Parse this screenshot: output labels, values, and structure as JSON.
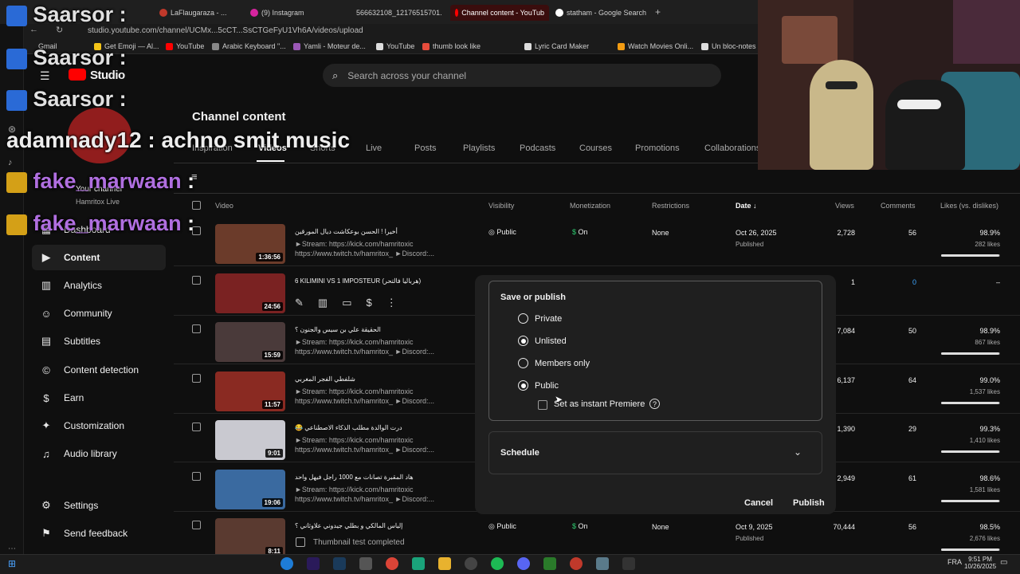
{
  "browser": {
    "tabs": [
      {
        "label": "LaFlaugaraza - ...",
        "active": false
      },
      {
        "label": "(9) Instagram",
        "active": false
      },
      {
        "label": "566632108_12176515701...",
        "active": false
      },
      {
        "label": "Channel content - YouTub",
        "active": true
      },
      {
        "label": "statham - Google Search",
        "active": false
      }
    ],
    "url": "studio.youtube.com/channel/UCMx...5cCT...SsCTGeFyU1Vh6A/videos/upload",
    "bookmarks": [
      "Gmail",
      "Get Emoji — Al...",
      "YouTube",
      "Arabic Keyboard \"...",
      "Yamli - Moteur de...",
      "YouTube",
      "thumb look like",
      "Lyric Card Maker",
      "Watch Movies Onli...",
      "Un bloc-notes e..."
    ]
  },
  "studio": {
    "logo_label": "Studio",
    "search_placeholder": "Search across your channel",
    "channel_label": "Your channel",
    "channel_name": "Hamritox Live",
    "nav": [
      {
        "label": "Dashboard",
        "icon": "dashboard-icon"
      },
      {
        "label": "Content",
        "icon": "content-icon"
      },
      {
        "label": "Analytics",
        "icon": "analytics-icon"
      },
      {
        "label": "Community",
        "icon": "community-icon"
      },
      {
        "label": "Subtitles",
        "icon": "subtitles-icon"
      },
      {
        "label": "Content detection",
        "icon": "copyright-icon"
      },
      {
        "label": "Earn",
        "icon": "dollar-icon"
      },
      {
        "label": "Customization",
        "icon": "wand-icon"
      },
      {
        "label": "Audio library",
        "icon": "audio-icon"
      }
    ],
    "nav_bottom": [
      {
        "label": "Settings",
        "icon": "gear-icon"
      },
      {
        "label": "Send feedback",
        "icon": "feedback-icon"
      }
    ]
  },
  "page": {
    "title": "Channel content",
    "tabs": [
      "Inspiration",
      "Videos",
      "Shorts",
      "Live",
      "Posts",
      "Playlists",
      "Podcasts",
      "Courses",
      "Promotions",
      "Collaborations"
    ],
    "columns": [
      "Video",
      "Visibility",
      "Monetization",
      "Restrictions",
      "Date",
      "Views",
      "Comments",
      "Likes (vs. dislikes)"
    ]
  },
  "videos": [
    {
      "title": "أخيرا ! الحسن بوعكاشت ديال المورقين",
      "desc1": "►Stream: https://kick.com/hamritoxic",
      "desc2": "https://www.twitch.tv/hamritox_ ►Discord:...",
      "duration": "1:36:56",
      "visibility": "Public",
      "monetization": "On",
      "restrictions": "None",
      "date": "Oct 26, 2025",
      "date_status": "Published",
      "views": "2,728",
      "comments": "56",
      "likes_pct": "98.9%",
      "likes_count": "282 likes",
      "like_ratio": 0.989,
      "thumb_color": "#6b3b2a"
    },
    {
      "title": "6 KILIMINI VS 1 IMPOSTEUR (هرباليا فالتحر)",
      "desc1": "",
      "desc2": "",
      "duration": "24:56",
      "visibility": "",
      "monetization": "",
      "restrictions": "",
      "date": "",
      "date_status": "",
      "views": "1",
      "comments": "0",
      "likes_pct": "–",
      "likes_count": "",
      "like_ratio": 0,
      "thumb_color": "#7a2222"
    },
    {
      "title": "الحقيقة علي بن سيس والجنون ؟",
      "desc1": "►Stream: https://kick.com/hamritoxic",
      "desc2": "https://www.twitch.tv/hamritox_ ►Discord:...",
      "duration": "15:59",
      "visibility": "",
      "monetization": "",
      "restrictions": "",
      "date": "",
      "date_status": "",
      "views": "7,084",
      "comments": "50",
      "likes_pct": "98.9%",
      "likes_count": "867 likes",
      "like_ratio": 0.989,
      "thumb_color": "#4a3a3a"
    },
    {
      "title": "شلفطي الفجر المغربي",
      "desc1": "►Stream: https://kick.com/hamritoxic",
      "desc2": "https://www.twitch.tv/hamritox_ ►Discord:...",
      "duration": "11:57",
      "visibility": "",
      "monetization": "",
      "restrictions": "",
      "date": "",
      "date_status": "",
      "views": "6,137",
      "comments": "64",
      "likes_pct": "99.0%",
      "likes_count": "1,537 likes",
      "like_ratio": 0.99,
      "thumb_color": "#8a2a22"
    },
    {
      "title": "😂 درت الوالدة مطلب الذكاء الاصطناعي",
      "desc1": "►Stream: https://kick.com/hamritoxic",
      "desc2": "https://www.twitch.tv/hamritox_ ►Discord:...",
      "duration": "9:01",
      "visibility": "",
      "monetization": "",
      "restrictions": "",
      "date": "",
      "date_status": "",
      "views": "1,390",
      "comments": "29",
      "likes_pct": "99.3%",
      "likes_count": "1,410 likes",
      "like_ratio": 0.993,
      "thumb_color": "#c9c9d0"
    },
    {
      "title": "هاد المقبرة تصانات مع 1000 راجل فيهل واحد",
      "desc1": "►Stream: https://kick.com/hamritoxic",
      "desc2": "https://www.twitch.tv/hamritox_ ►Discord:...",
      "duration": "19:06",
      "visibility": "",
      "monetization": "",
      "restrictions": "",
      "date": "",
      "date_status": "",
      "views": "2,949",
      "comments": "61",
      "likes_pct": "98.6%",
      "likes_count": "1,581 likes",
      "like_ratio": 0.986,
      "thumb_color": "#3a6aa0"
    },
    {
      "title": "إلياس المالكي و بطلي جيدوني علاوثاني ؟",
      "desc1": "Thumbnail test completed",
      "desc2": "",
      "duration": "8:11",
      "visibility": "Public",
      "monetization": "On",
      "restrictions": "None",
      "date": "Oct 9, 2025",
      "date_status": "Published",
      "views": "70,444",
      "comments": "56",
      "likes_pct": "98.5%",
      "likes_count": "2,676 likes",
      "like_ratio": 0.985,
      "thumb_color": "#5a3a30"
    }
  ],
  "dialog": {
    "title": "Save or publish",
    "options": [
      "Private",
      "Unlisted",
      "Members only",
      "Public"
    ],
    "selected": "Public",
    "premiere_label": "Set as instant Premiere",
    "schedule_label": "Schedule",
    "cancel": "Cancel",
    "publish": "Publish"
  },
  "overlay_chat": [
    {
      "name": "Saarsor",
      "text": ":"
    },
    {
      "name": "Saarsor",
      "text": ":"
    },
    {
      "name": "Saarsor",
      "text": ":"
    },
    {
      "name": "adamnady12",
      "text": ": achno smit music"
    },
    {
      "name": "fake_marwaan",
      "text": ":"
    },
    {
      "name": "fake_marwaan",
      "text": ":"
    }
  ],
  "taskbar": {
    "lang": "FRA",
    "time": "9:51 PM",
    "date": "10/26/2025"
  }
}
